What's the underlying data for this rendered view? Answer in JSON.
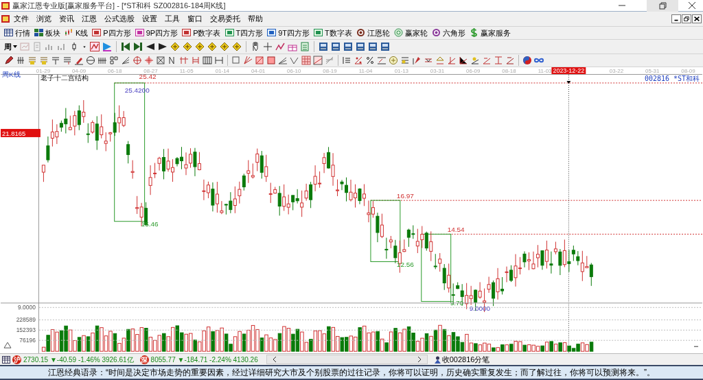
{
  "window": {
    "title": "赢家江恩专业版[赢家服务平台] - [*ST和科  SZ002816-184周K线]"
  },
  "menu": [
    "文件",
    "浏览",
    "资讯",
    "江恩",
    "公式选股",
    "设置",
    "工具",
    "窗口",
    "交易委托",
    "帮助"
  ],
  "toolbar": [
    {
      "label": "行情",
      "kind": "grid"
    },
    {
      "label": "板块",
      "kind": "blocks"
    },
    {
      "label": "K线",
      "kind": "candles"
    },
    {
      "label": "P四方形",
      "kind": "square-red"
    },
    {
      "label": "9P四方形",
      "kind": "square-pink"
    },
    {
      "label": "P数字表",
      "kind": "square-red"
    },
    {
      "label": "T四方形",
      "kind": "square-green"
    },
    {
      "label": "9T四方形",
      "kind": "square-blue"
    },
    {
      "label": "T数字表",
      "kind": "square-green"
    },
    {
      "label": "江恩轮",
      "kind": "ring"
    },
    {
      "label": "赢家轮",
      "kind": "ring-green"
    },
    {
      "label": "六角形",
      "kind": "ring-purple"
    },
    {
      "label": "赢家服务",
      "kind": "dollar"
    }
  ],
  "period": "周",
  "chart": {
    "panel_label": "周K线",
    "title": "老子十二宫结构",
    "symbol": "002816 *ST和科",
    "price_marker": "21.8165",
    "dates": [
      {
        "label": "01-29",
        "selected": false
      },
      {
        "label": "04-09",
        "selected": false
      },
      {
        "label": "06-18",
        "selected": false
      },
      {
        "label": "08-27",
        "selected": false
      },
      {
        "label": "11-05",
        "selected": false
      },
      {
        "label": "01-14",
        "selected": false
      },
      {
        "label": "04-01",
        "selected": false
      },
      {
        "label": "06-10",
        "selected": false
      },
      {
        "label": "08-19",
        "selected": false
      },
      {
        "label": "11-04",
        "selected": false
      },
      {
        "label": "01-13",
        "selected": false
      },
      {
        "label": "03-31",
        "selected": false
      },
      {
        "label": "06-09",
        "selected": false
      },
      {
        "label": "08-18",
        "selected": false
      },
      {
        "label": "11-03",
        "selected": false
      },
      {
        "label": "2023-12-22",
        "selected": true
      },
      {
        "label": "03-22",
        "selected": false
      },
      {
        "label": "05-31",
        "selected": false
      },
      {
        "label": "08-09",
        "selected": false
      }
    ],
    "annotations": [
      {
        "text": "25.42",
        "kind": "high"
      },
      {
        "text": "25.4200",
        "kind": "point"
      },
      {
        "text": "15.46",
        "kind": "low"
      },
      {
        "text": "16.97",
        "kind": "high"
      },
      {
        "text": "12.56",
        "kind": "low"
      },
      {
        "text": "14.54",
        "kind": "high"
      },
      {
        "text": "9.70",
        "kind": "low"
      },
      {
        "text": "9.0000",
        "kind": "point"
      }
    ],
    "volume_axis": [
      "9.0000",
      "228589",
      "152393",
      "76196"
    ]
  },
  "status_bar": {
    "indices": [
      {
        "badge": "沪",
        "text": "2730.15 ▼-40.59 -1.46% 3926.61亿"
      },
      {
        "badge": "深",
        "text": "8055.77 ▼-184.71 -2.24% 4130.26"
      }
    ],
    "tick_link": "收002816分笔"
  },
  "ticker": "江恩经典语录：“时间是决定市场走势的重要因素，经过详细研究大市及个别股票的过往记录，你将可以证明，历史确实重复发生；而了解过往，你将可以预测将来。”。"
}
